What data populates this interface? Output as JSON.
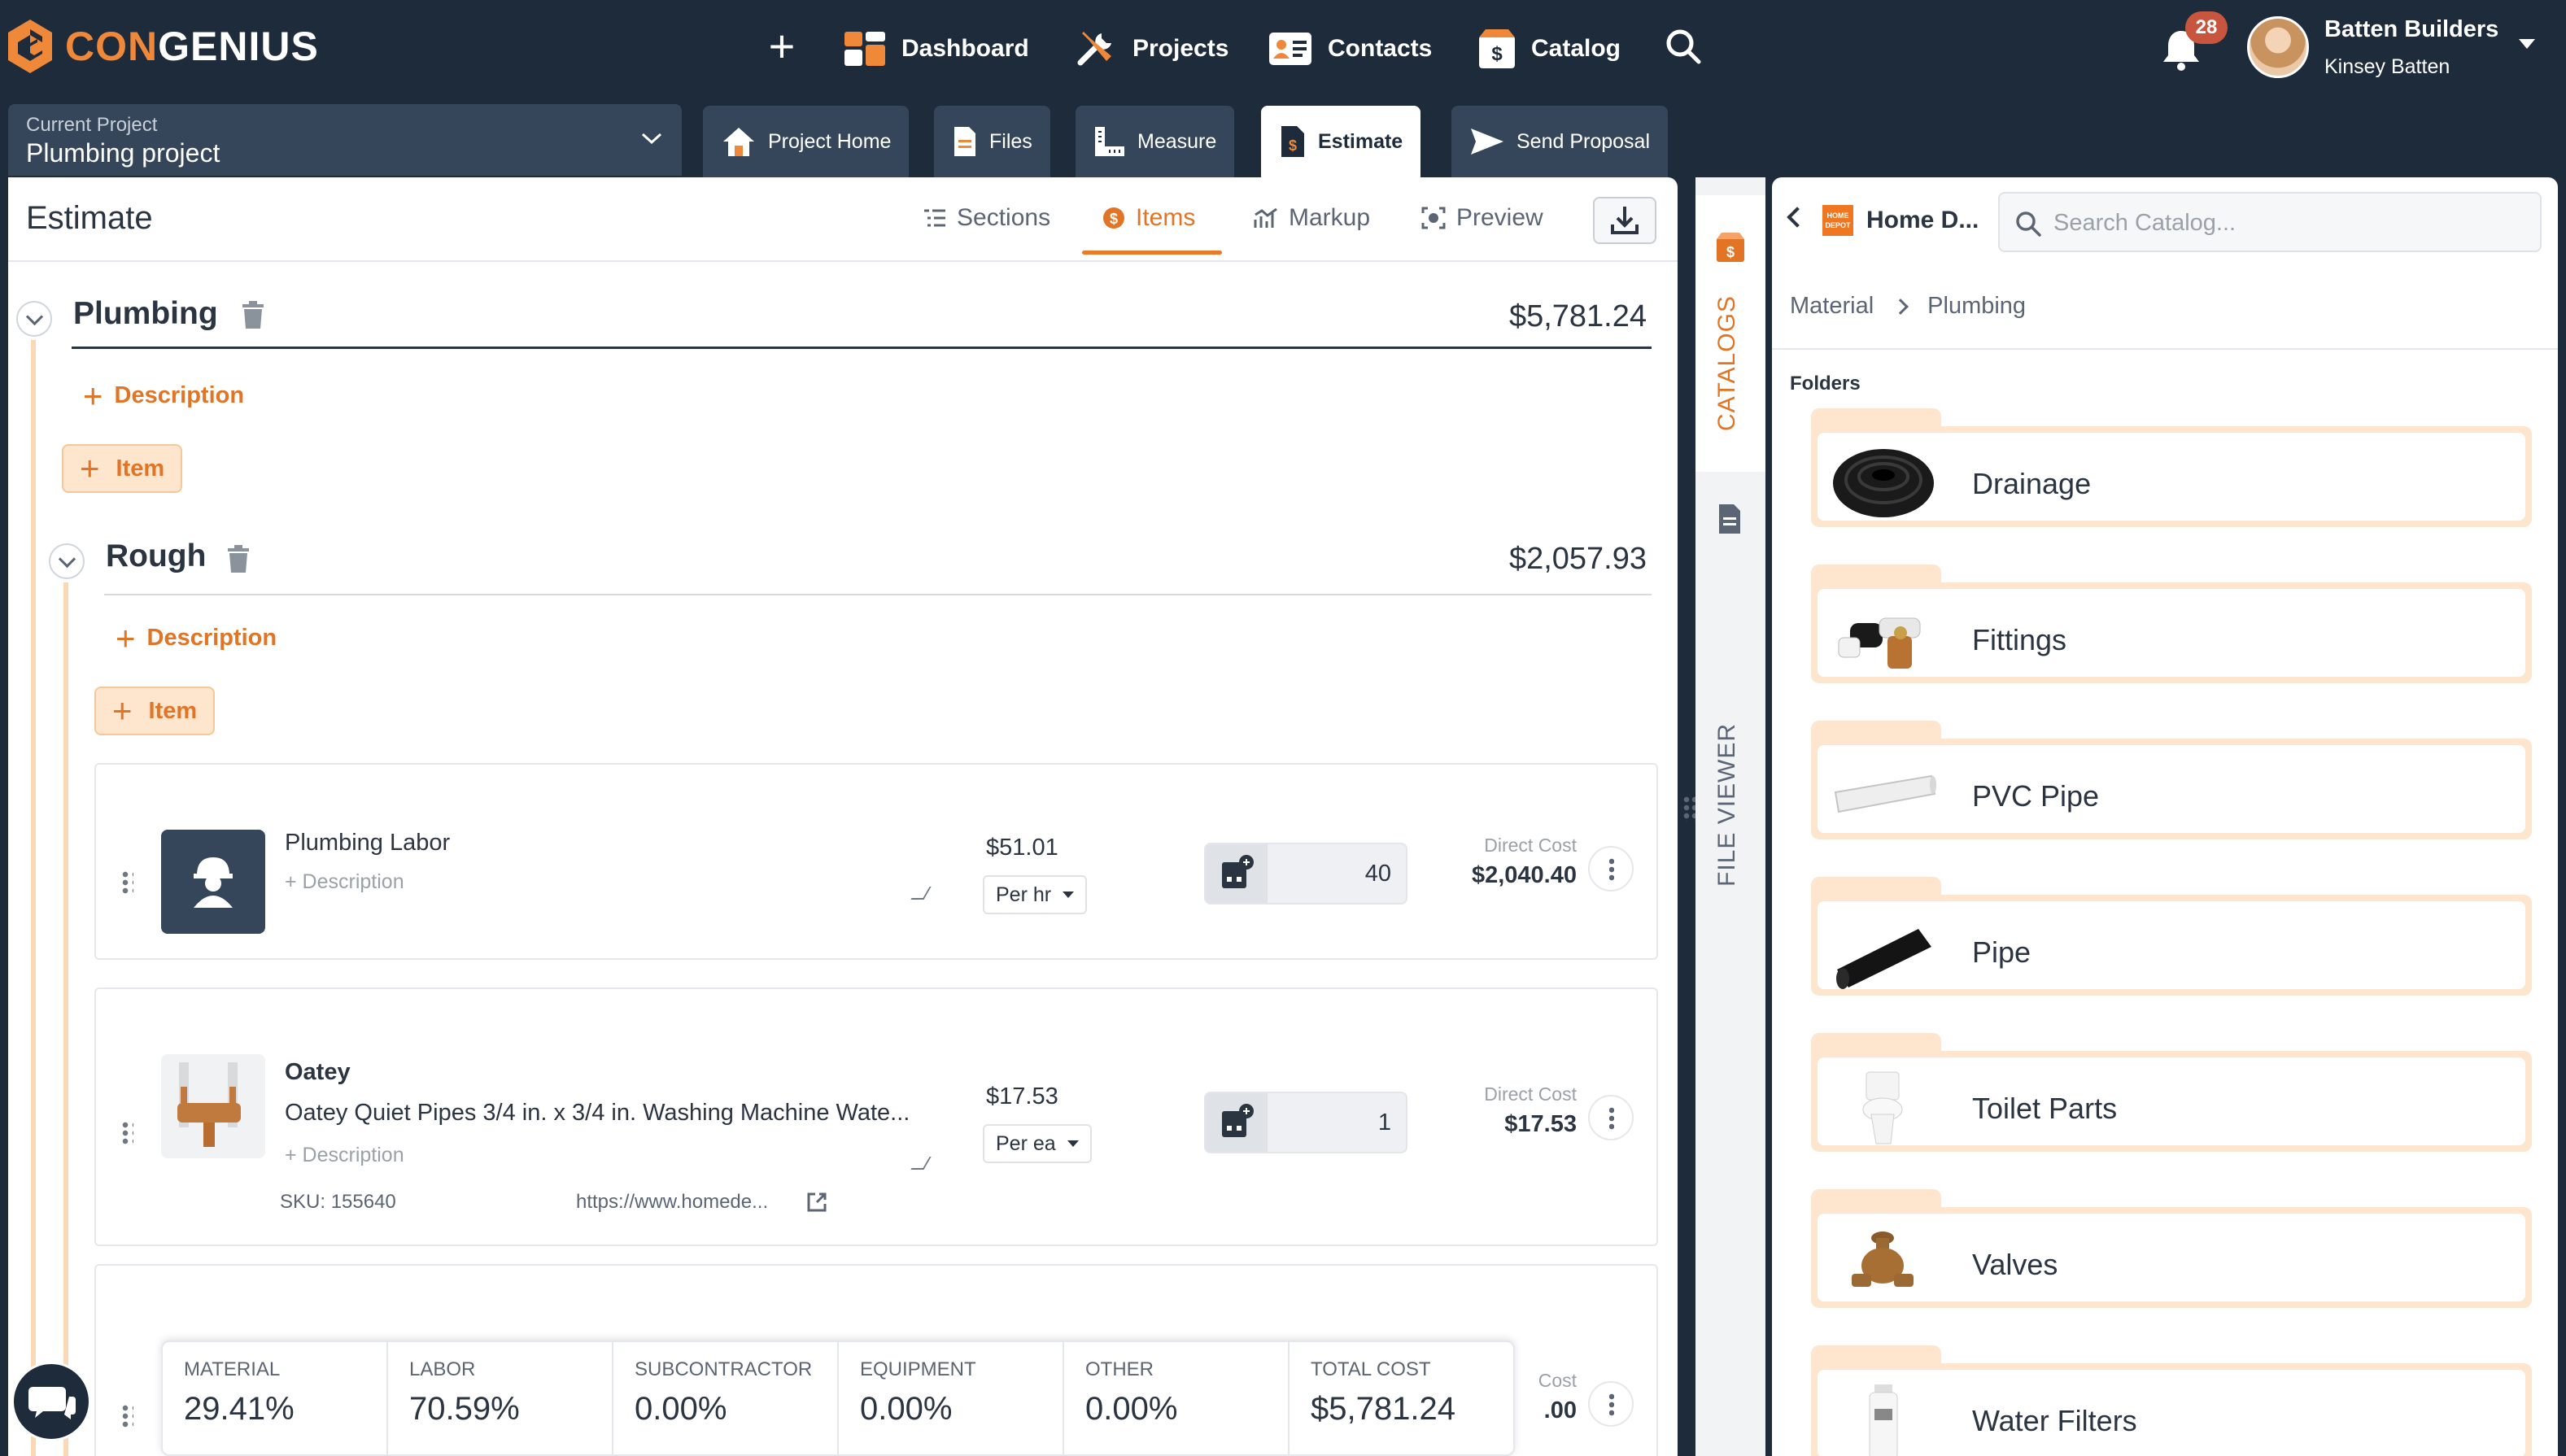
{
  "app": {
    "brand_con": "CON",
    "brand_genius": "GENIUS"
  },
  "nav": {
    "dashboard": "Dashboard",
    "projects": "Projects",
    "contacts": "Contacts",
    "catalog": "Catalog"
  },
  "notifications": {
    "count": "28"
  },
  "user": {
    "company": "Batten Builders",
    "name": "Kinsey Batten"
  },
  "project": {
    "label": "Current Project",
    "name": "Plumbing project"
  },
  "tabs": {
    "home": "Project Home",
    "files": "Files",
    "measure": "Measure",
    "estimate": "Estimate",
    "proposal": "Send Proposal"
  },
  "estimate": {
    "title": "Estimate",
    "subtabs": {
      "sections": "Sections",
      "items": "Items",
      "markup": "Markup",
      "preview": "Preview"
    },
    "add_description": "Description",
    "add_item": "Item",
    "sections": [
      {
        "title": "Plumbing",
        "amount": "$5,781.24"
      },
      {
        "title": "Rough",
        "amount": "$2,057.93"
      }
    ],
    "items": [
      {
        "type": "Labor",
        "name": "Plumbing Labor",
        "desc_placeholder": "+ Description",
        "price": "$51.01",
        "unit": "Per hr",
        "qty": "40",
        "direct_cost_label": "Direct Cost",
        "direct_cost": "$2,040.40"
      },
      {
        "type": "Material",
        "brand": "Oatey",
        "name": "Oatey Quiet Pipes 3/4 in. x 3/4 in. Washing Machine Wate...",
        "desc_placeholder": "+ Description",
        "price": "$17.53",
        "unit": "Per ea",
        "qty": "1",
        "direct_cost_label": "Direct Cost",
        "direct_cost": "$17.53",
        "sku_label": "SKU:",
        "sku": "155640",
        "link": "https://www.homede..."
      },
      {
        "type": "Material",
        "direct_cost_label": "Cost",
        "direct_cost": ".00"
      }
    ]
  },
  "summary": [
    {
      "label": "MATERIAL",
      "value": "29.41%"
    },
    {
      "label": "LABOR",
      "value": "70.59%"
    },
    {
      "label": "SUBCONTRACTOR",
      "value": "0.00%"
    },
    {
      "label": "EQUIPMENT",
      "value": "0.00%"
    },
    {
      "label": "OTHER",
      "value": "0.00%"
    },
    {
      "label": "TOTAL COST",
      "value": "$5,781.24"
    }
  ],
  "side_tabs": {
    "catalogs": "CATALOGS",
    "file_viewer": "FILE VIEWER"
  },
  "catalog": {
    "store": "Home D...",
    "store_logo": "HOME DEPOT",
    "search_placeholder": "Search Catalog...",
    "breadcrumb": [
      "Material",
      "Plumbing"
    ],
    "folders_label": "Folders",
    "folders": [
      "Drainage",
      "Fittings",
      "PVC Pipe",
      "Pipe",
      "Toilet Parts",
      "Valves",
      "Water Filters"
    ]
  },
  "colors": {
    "accent": "#e27425",
    "nav_bg": "#1d2b3a",
    "labor_tag": "#d9762a",
    "material_tag": "#3f86cf",
    "folder": "#fde6cd"
  }
}
